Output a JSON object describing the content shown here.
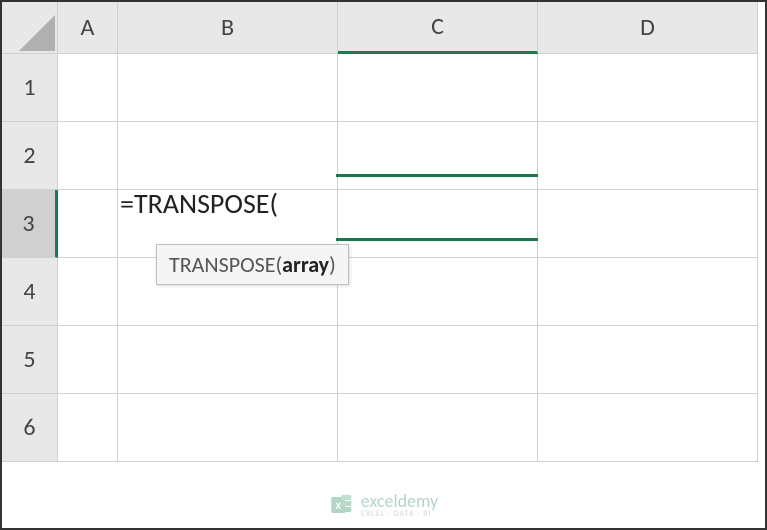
{
  "columns": [
    "A",
    "B",
    "C",
    "D"
  ],
  "rows": [
    "1",
    "2",
    "3",
    "4",
    "5",
    "6"
  ],
  "active_cell": "C3",
  "active_row": "3",
  "active_col": "C",
  "formula": "=TRANSPOSE(",
  "tooltip_func": "TRANSPOSE(",
  "tooltip_arg": "array",
  "tooltip_close": ")",
  "watermark_brand": "exceldemy",
  "watermark_tag": "EXCEL · DATA · BI"
}
